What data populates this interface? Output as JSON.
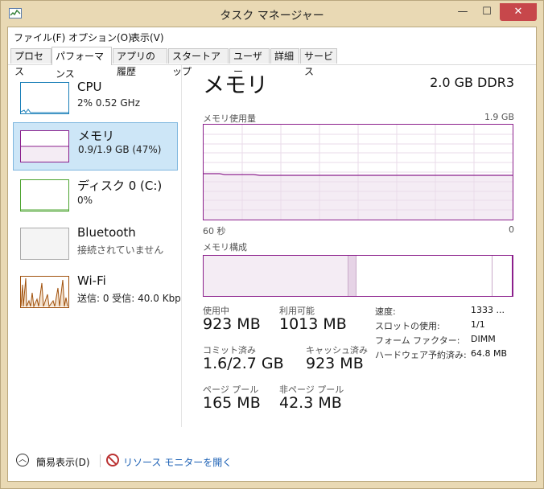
{
  "window": {
    "title": "タスク マネージャー",
    "controls": {
      "minimize": "—",
      "maximize": "☐",
      "close": "✕"
    }
  },
  "menu": [
    "ファイル(F)",
    "オプション(O)",
    "表示(V)"
  ],
  "tabs": [
    "プロセス",
    "パフォーマンス",
    "アプリの履歴",
    "スタートアップ",
    "ユーザー",
    "詳細",
    "サービス"
  ],
  "active_tab": "パフォーマンス",
  "sidebar": {
    "items": [
      {
        "name": "CPU",
        "detail": "2% 0.52 GHz",
        "color": "#1a7fb8"
      },
      {
        "name": "メモリ",
        "detail": "0.9/1.9 GB (47%)",
        "color": "#8b1f8c",
        "selected": true
      },
      {
        "name": "ディスク 0 (C:)",
        "detail": "0%",
        "color": "#4da431"
      },
      {
        "name": "Bluetooth",
        "detail": "接続されていません",
        "color": "#999999"
      },
      {
        "name": "Wi-Fi",
        "detail": "送信: 0 受信: 40.0 Kbp",
        "color": "#a1520e"
      }
    ]
  },
  "main": {
    "title": "メモリ",
    "spec": "2.0 GB DDR3",
    "usage_chart": {
      "label": "メモリ使用量",
      "max_label": "1.9 GB",
      "axis_left": "60 秒",
      "axis_right": "0",
      "level_fraction": 0.47
    },
    "composition": {
      "label": "メモリ構成",
      "segments": [
        {
          "kind": "in-use",
          "fraction": 0.47
        },
        {
          "kind": "modified",
          "fraction": 0.025
        },
        {
          "kind": "standby",
          "fraction": 0.44
        },
        {
          "kind": "free",
          "fraction": 0.065
        }
      ]
    },
    "stats": [
      {
        "label": "使用中",
        "value": "923 MB"
      },
      {
        "label": "利用可能",
        "value": "1013 MB"
      },
      {
        "label": "コミット済み",
        "value": "1.6/2.7 GB"
      },
      {
        "label": "キャッシュ済み",
        "value": "923 MB"
      },
      {
        "label": "ページ プール",
        "value": "165 MB"
      },
      {
        "label": "非ページ プール",
        "value": "42.3 MB"
      }
    ],
    "details": [
      {
        "label": "速度:",
        "value": "1333 ..."
      },
      {
        "label": "スロットの使用:",
        "value": "1/1"
      },
      {
        "label": "フォーム ファクター:",
        "value": "DIMM"
      },
      {
        "label": "ハードウェア予約済み:",
        "value": "64.8 MB"
      }
    ]
  },
  "footer": {
    "fewer_details": "簡易表示(D)",
    "fewer_glyph": "︿",
    "resource_monitor": "リソース モニターを開く"
  }
}
